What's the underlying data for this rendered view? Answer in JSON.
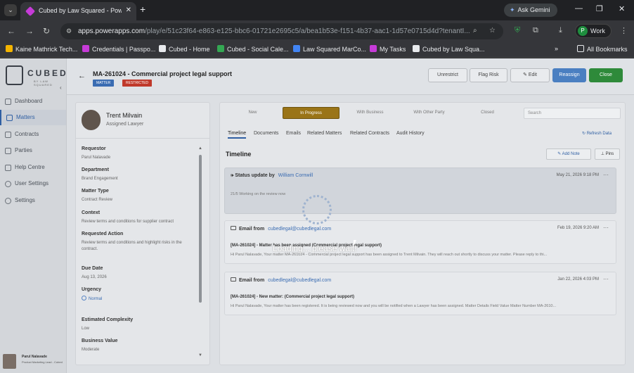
{
  "browser": {
    "tab_title": "Cubed by Law Squared - Power Apps",
    "gemini_label": "Ask Gemini",
    "url_host": "apps.powerapps.com",
    "url_path": "/play/e/51c23f64-e863-e125-bbc6-01721e2695c5/a/bea1b53e-f151-4b37-aac1-1d57e0715d4d?tenantI...",
    "profile_letter": "P",
    "profile_name": "Work",
    "bookmarks": [
      {
        "label": "Kaine Mathrick Tech...",
        "color": "#f4b400"
      },
      {
        "label": "Credentials | Passpo...",
        "color": "#c63bd8"
      },
      {
        "label": "Cubed - Home",
        "color": "#e8eaed"
      },
      {
        "label": "Cubed - Social Cale...",
        "color": "#34a853"
      },
      {
        "label": "Law Squared MarCo...",
        "color": "#4285f4"
      },
      {
        "label": "My Tasks",
        "color": "#c63bd8"
      },
      {
        "label": "Cubed by Law Squa...",
        "color": "#e8eaed"
      }
    ],
    "all_bookmarks": "All Bookmarks"
  },
  "sidebar": {
    "brand": "CUBED",
    "brand_sub": "BY LAW SQUARED",
    "items": [
      {
        "label": "Dashboard"
      },
      {
        "label": "Matters"
      },
      {
        "label": "Contracts"
      },
      {
        "label": "Parties"
      },
      {
        "label": "Help Centre"
      },
      {
        "label": "User Settings"
      },
      {
        "label": "Settings"
      }
    ],
    "user_name": "Parul Nalavade",
    "user_role": "Product Marketing Lead - Cubed"
  },
  "header": {
    "title": "MA-261024 - Commercial project legal support",
    "badges": [
      {
        "label": "MATTER",
        "color": "#3a6cb2"
      },
      {
        "label": "RESTRICTED",
        "color": "#c0392b"
      }
    ],
    "buttons": {
      "unrestrict": "Unrestrict",
      "flag_risk": "Flag Risk",
      "edit": "Edit",
      "reassign": "Reassign",
      "close": "Close"
    }
  },
  "lawyer": {
    "name": "Trent Milvain",
    "role": "Assigned Lawyer"
  },
  "fields": [
    {
      "label": "Requestor",
      "value": "Parul Nalavade"
    },
    {
      "label": "Department",
      "value": "Brand Engagement"
    },
    {
      "label": "Matter Type",
      "value": "Contract Review"
    },
    {
      "label": "Context",
      "value": "Review terms and conditions for supplier contract"
    },
    {
      "label": "Requested Action",
      "value": "Review terms and conditions and highlight risks in the contract."
    },
    {
      "label": "Due Date",
      "value": "Aug 13, 2026"
    },
    {
      "label": "Urgency",
      "value": "Normal"
    },
    {
      "label": "Estimated Complexity",
      "value": "Low"
    },
    {
      "label": "Business Value",
      "value": "Moderate"
    }
  ],
  "stages": [
    {
      "label": "New"
    },
    {
      "label": "In Progress"
    },
    {
      "label": "With Business"
    },
    {
      "label": "With Other Party"
    },
    {
      "label": "Closed"
    }
  ],
  "search_placeholder": "Search",
  "tabs": [
    {
      "label": "Timeline"
    },
    {
      "label": "Documents"
    },
    {
      "label": "Emails"
    },
    {
      "label": "Related Matters"
    },
    {
      "label": "Related Contracts"
    },
    {
      "label": "Audit History"
    }
  ],
  "refresh_label": "Refresh Data",
  "timeline": {
    "title": "Timeline",
    "add_note": "Add Note",
    "pins": "Pins",
    "entries": [
      {
        "head": "Status update by",
        "who": "William Cornwill",
        "date": "May 21, 2026 9:18 PM",
        "body": "21/5 Working on the review now"
      },
      {
        "head": "Email from",
        "who": "cubedlegal@cubedlegal.com",
        "date": "Feb 19, 2026 9:20 AM",
        "subject": "[MA-261024] - Matter has been assigned (Commercial project legal support)",
        "body": "Hi Parul Nalavade, Your matter MA-261024 - Commercial project legal support has been assigned to Trent Milvain. They will reach out shortly to discuss your matter. Please reply to thi..."
      },
      {
        "head": "Email from",
        "who": "cubedlegal@cubedlegal.com",
        "date": "Jan 22, 2026 4:03 PM",
        "subject": "[MA-261024] - New matter: (Commercial project legal support)",
        "body": "Hi Parul Nalavade, Your matter has been registered. It is being reviewed now and you will be notified when a Lawyer has been assigned. Matter Details Field Value Matter Number MA-2610..."
      }
    ]
  },
  "loading_text": "Loading... please wait!"
}
